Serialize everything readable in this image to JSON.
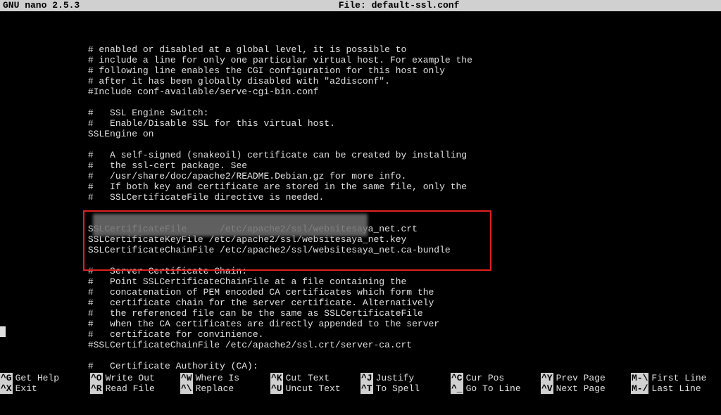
{
  "header": {
    "app": "  GNU nano  2.5.3",
    "file": "File: default-ssl.conf"
  },
  "content": {
    "lines": [
      "",
      "                # enabled or disabled at a global level, it is possible to",
      "                # include a line for only one particular virtual host. For example the",
      "                # following line enables the CGI configuration for this host only",
      "                # after it has been globally disabled with \"a2disconf\".",
      "                #Include conf-available/serve-cgi-bin.conf",
      "",
      "                #   SSL Engine Switch:",
      "                #   Enable/Disable SSL for this virtual host.",
      "                SSLEngine on",
      "",
      "                #   A self-signed (snakeoil) certificate can be created by installing",
      "                #   the ssl-cert package. See",
      "                #   /usr/share/doc/apache2/README.Debian.gz for more info.",
      "                #   If both key and certificate are stored in the same file, only the",
      "                #   SSLCertificateFile directive is needed.",
      "",
      "",
      "                SSLCertificateFile      /etc/apache2/ssl/websitesaya_net.crt",
      "                SSLCertificateKeyFile /etc/apache2/ssl/websitesaya_net.key",
      "                SSLCertificateChainFile /etc/apache2/ssl/websitesaya_net.ca-bundle",
      "",
      "                #   Server Certificate Chain:",
      "                #   Point SSLCertificateChainFile at a file containing the",
      "                #   concatenation of PEM encoded CA certificates which form the",
      "                #   certificate chain for the server certificate. Alternatively",
      "                #   the referenced file can be the same as SSLCertificateFile",
      "                #   when the CA certificates are directly appended to the server",
      "                #   certificate for convinience.",
      "                #SSLCertificateChainFile /etc/apache2/ssl.crt/server-ca.crt",
      "",
      "                #   Certificate Authority (CA):"
    ]
  },
  "footer": {
    "row1": [
      {
        "key": "^G",
        "label": "Get Help"
      },
      {
        "key": "^O",
        "label": "Write Out"
      },
      {
        "key": "^W",
        "label": "Where Is"
      },
      {
        "key": "^K",
        "label": "Cut Text"
      },
      {
        "key": "^J",
        "label": "Justify"
      },
      {
        "key": "^C",
        "label": "Cur Pos"
      },
      {
        "key": "^Y",
        "label": "Prev Page"
      },
      {
        "key": "M-\\",
        "label": "First Line"
      }
    ],
    "row2": [
      {
        "key": "^X",
        "label": "Exit"
      },
      {
        "key": "^R",
        "label": "Read File"
      },
      {
        "key": "^\\",
        "label": "Replace"
      },
      {
        "key": "^U",
        "label": "Uncut Text"
      },
      {
        "key": "^T",
        "label": "To Spell"
      },
      {
        "key": "^_",
        "label": "Go To Line"
      },
      {
        "key": "^V",
        "label": "Next Page"
      },
      {
        "key": "M-/",
        "label": "Last Line"
      }
    ]
  }
}
